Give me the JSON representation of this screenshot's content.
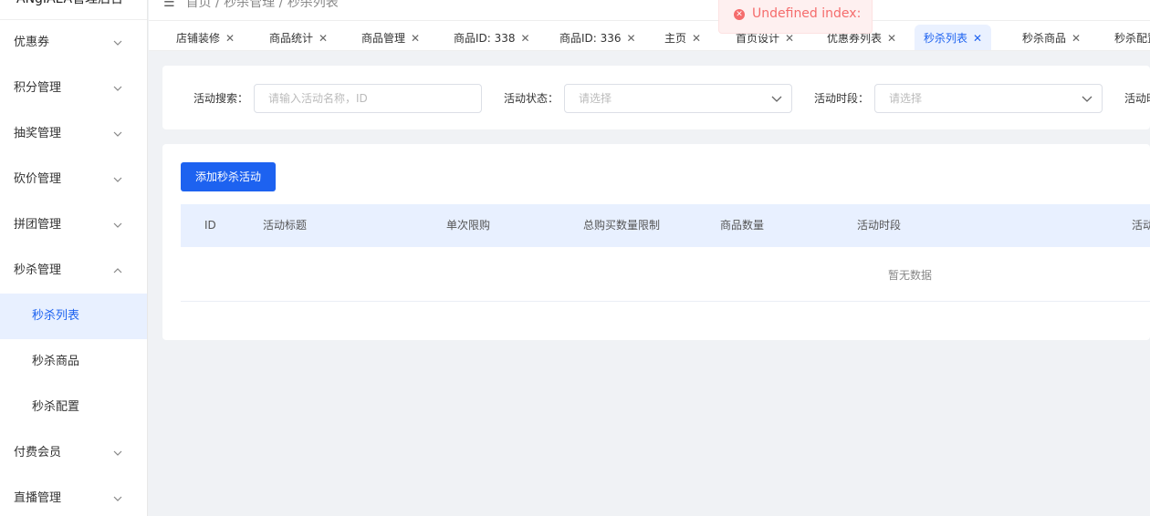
{
  "sidebar": {
    "logo": "ANgIAEA管理后台",
    "items": [
      {
        "label": "优惠券",
        "expanded": false
      },
      {
        "label": "积分管理",
        "expanded": false
      },
      {
        "label": "抽奖管理",
        "expanded": false
      },
      {
        "label": "砍价管理",
        "expanded": false
      },
      {
        "label": "拼团管理",
        "expanded": false
      },
      {
        "label": "秒杀管理",
        "expanded": true
      },
      {
        "label": "付费会员",
        "expanded": false
      },
      {
        "label": "直播管理",
        "expanded": false
      }
    ],
    "subitems": [
      {
        "label": "秒杀列表",
        "active": true
      },
      {
        "label": "秒杀商品",
        "active": false
      },
      {
        "label": "秒杀配置",
        "active": false
      }
    ]
  },
  "topbar": {
    "breadcrumb": "首页 / 秒杀管理 / 秒杀列表"
  },
  "tabs": [
    {
      "label": "店铺装修"
    },
    {
      "label": "商品统计"
    },
    {
      "label": "商品管理"
    },
    {
      "label": "商品ID: 338"
    },
    {
      "label": "商品ID: 336"
    },
    {
      "label": "主页"
    },
    {
      "label": "首页设计"
    },
    {
      "label": "优惠券列表"
    },
    {
      "label": "秒杀列表",
      "active": true
    },
    {
      "label": "秒杀商品"
    },
    {
      "label": "秒杀配置"
    }
  ],
  "toast": {
    "message": "Undefined index:"
  },
  "search": {
    "name_label": "活动搜索：",
    "name_placeholder": "请输入活动名称，ID",
    "status_label": "活动状态：",
    "status_placeholder": "请选择",
    "period_label": "活动时段：",
    "period_placeholder": "请选择",
    "extra_label": "活动时"
  },
  "table": {
    "add_button": "添加秒杀活动",
    "columns": [
      "ID",
      "活动标题",
      "单次限购",
      "总购买数量限制",
      "商品数量",
      "活动时段",
      "活动"
    ],
    "empty_text": "暂无数据"
  },
  "colors": {
    "accent": "#1d62f0",
    "active_bg": "#e8f0ff",
    "error": "#f56c6c"
  }
}
